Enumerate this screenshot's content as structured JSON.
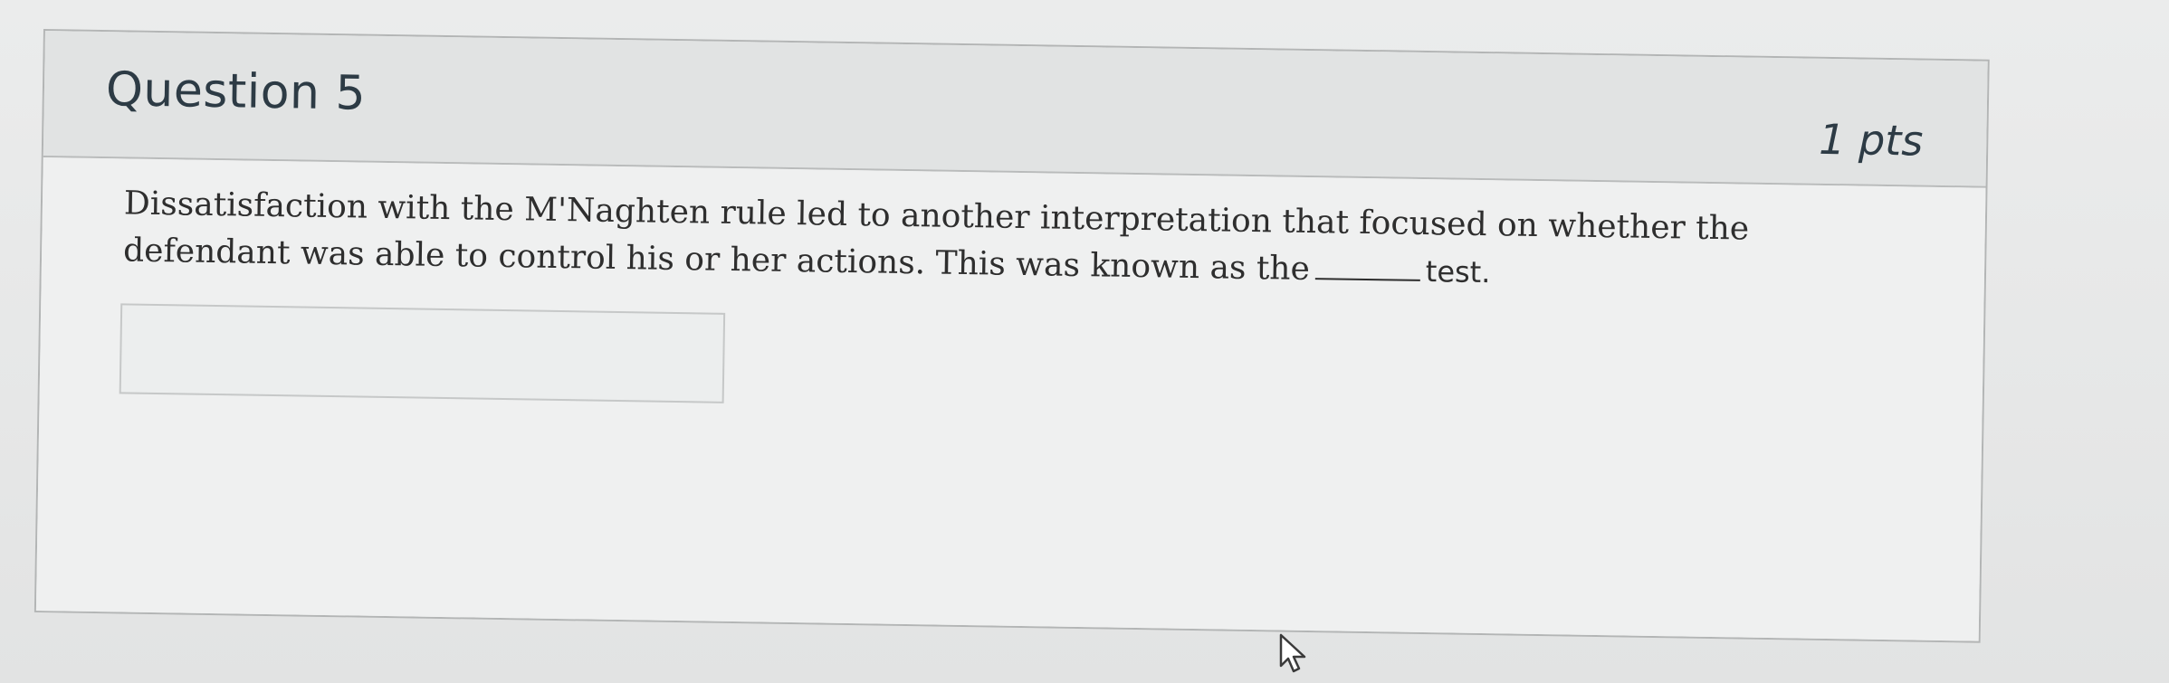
{
  "question": {
    "title": "Question 5",
    "points": "1 pts",
    "text_before_blank": "Dissatisfaction with the M'Naghten rule led to another interpretation that focused on whether the defendant was able to control his or her actions. This was known as the",
    "text_after_blank": "test.",
    "answer_value": "",
    "answer_placeholder": ""
  },
  "icons": {
    "cursor": "mouse-pointer-icon"
  },
  "colors": {
    "header_background": "#e1e3e3",
    "title_text": "#2d3b45",
    "border": "#b3b5b5"
  }
}
